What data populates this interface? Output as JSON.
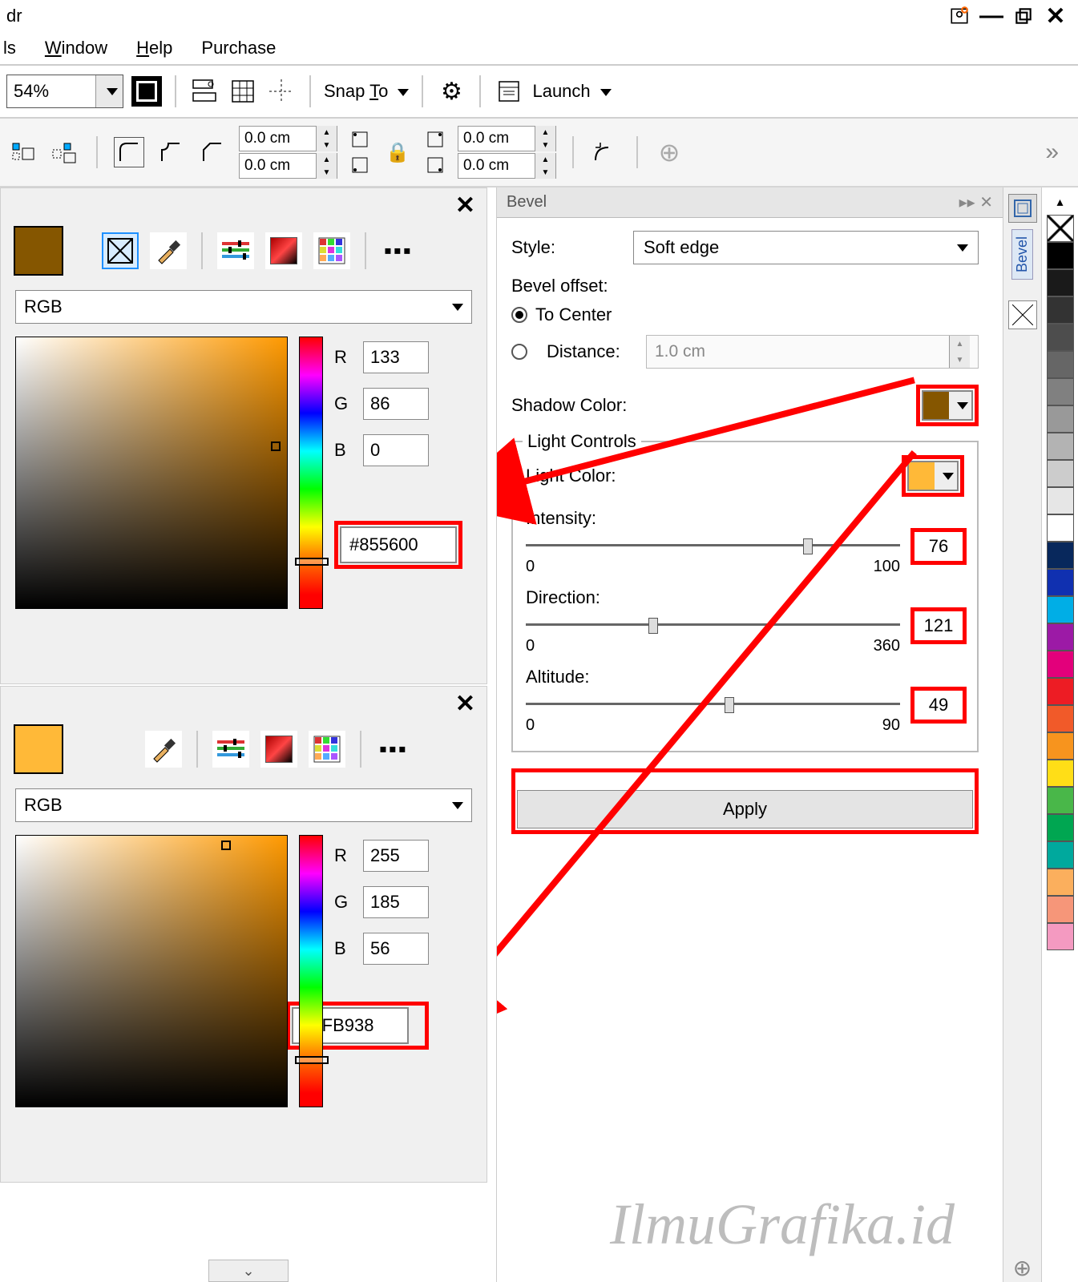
{
  "title_fragment": "dr",
  "menus": {
    "tools": "ls",
    "window": "Window",
    "help": "Help",
    "purchase": "Purchase"
  },
  "toolbar": {
    "zoom": "54%",
    "snap_to": "Snap To",
    "launch": "Launch"
  },
  "propbar": {
    "dims_w": "0.0 cm",
    "dims_h": "0.0 cm",
    "dims_w2": "0.0 cm",
    "dims_h2": "0.0 cm"
  },
  "color_picker_1": {
    "model": "RGB",
    "r": "133",
    "g": "86",
    "b": "0",
    "hex": "#855600",
    "swatch": "#855600"
  },
  "color_picker_2": {
    "model": "RGB",
    "r": "255",
    "g": "185",
    "b": "56",
    "hex": "#FFB938",
    "swatch": "#FFB938"
  },
  "bevel": {
    "title": "Bevel",
    "style_label": "Style:",
    "style_value": "Soft edge",
    "offset_label": "Bevel offset:",
    "to_center": "To Center",
    "distance_label": "Distance:",
    "distance_value": "1.0 cm",
    "shadow_color_label": "Shadow Color:",
    "shadow_color": "#855600",
    "light_controls": "Light Controls",
    "light_color_label": "Light Color:",
    "light_color": "#FFB938",
    "intensity_label": "Intensity:",
    "intensity_value": "76",
    "intensity_min": "0",
    "intensity_max": "100",
    "direction_label": "Direction:",
    "direction_value": "121",
    "direction_min": "0",
    "direction_max": "360",
    "altitude_label": "Altitude:",
    "altitude_value": "49",
    "altitude_min": "0",
    "altitude_max": "90",
    "apply": "Apply"
  },
  "dock": {
    "tab": "Bevel"
  },
  "palette": [
    "#000000",
    "#1a1a1a",
    "#333333",
    "#4d4d4d",
    "#666666",
    "#808080",
    "#999999",
    "#b3b3b3",
    "#cccccc",
    "#e6e6e6",
    "#ffffff",
    "#08285c",
    "#1030b0",
    "#00aee6",
    "#9c1aa6",
    "#e3007b",
    "#ed1c24",
    "#f15a29",
    "#f7941e",
    "#ffde17",
    "#49b749",
    "#00a651",
    "#00a99d",
    "#fbaf5d",
    "#f69679",
    "#f49ac1"
  ],
  "watermark": "IlmuGrafika.id",
  "labels": {
    "R": "R",
    "G": "G",
    "B": "B"
  }
}
